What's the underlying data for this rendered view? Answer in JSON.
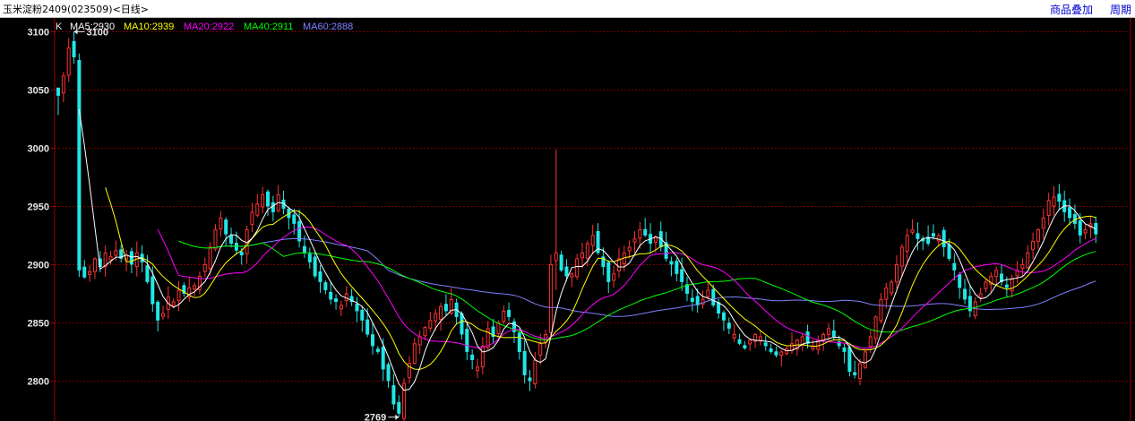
{
  "window": {
    "title": "玉米淀粉2409(023509)<日线>",
    "overlay_link": "商品叠加",
    "period_link": "周期"
  },
  "colors": {
    "background": "#000000",
    "axis": "#a00000",
    "grid": "#7a0000",
    "up_candle": "#ff3232",
    "down_candle": "#22e6e6",
    "axis_text": "#e6e6e6",
    "ma5": "#ffffff",
    "ma10": "#ffff00",
    "ma20": "#ff00ff",
    "ma40": "#00ff00",
    "ma60": "#8080ff"
  },
  "chart_data": {
    "type": "candlestick",
    "ylim": [
      2768,
      3108
    ],
    "y_ticks": [
      2800,
      2850,
      2900,
      2950,
      3000,
      3050,
      3100
    ],
    "grid": true,
    "legend_position": "top-left",
    "legend": {
      "k": "K",
      "ma5": "MA5:2930",
      "ma10": "MA10:2939",
      "ma20": "MA20:2922",
      "ma40": "MA40:2911",
      "ma60": "MA60:2888"
    },
    "annotations": {
      "high": {
        "label": "3100",
        "value": 3100,
        "bar": 3
      },
      "low": {
        "label": "2769",
        "value": 2769,
        "bar": 65
      }
    },
    "ma_start": {
      "ma5": 4,
      "ma10": 9,
      "ma20": 19,
      "ma40": 23,
      "ma60": 29
    },
    "closes": [
      3045,
      3062,
      3086,
      3078,
      2895,
      2889,
      2894,
      2905,
      2898,
      2910,
      2907,
      2912,
      2905,
      2908,
      2900,
      2910,
      2902,
      2885,
      2866,
      2852,
      2858,
      2872,
      2868,
      2878,
      2875,
      2880,
      2882,
      2890,
      2900,
      2915,
      2930,
      2940,
      2926,
      2918,
      2912,
      2908,
      2930,
      2945,
      2952,
      2960,
      2950,
      2945,
      2960,
      2948,
      2940,
      2935,
      2920,
      2910,
      2902,
      2890,
      2885,
      2878,
      2870,
      2868,
      2865,
      2875,
      2868,
      2860,
      2852,
      2840,
      2830,
      2825,
      2810,
      2800,
      2780,
      2772,
      2798,
      2815,
      2832,
      2838,
      2846,
      2852,
      2858,
      2864,
      2860,
      2870,
      2855,
      2840,
      2825,
      2818,
      2812,
      2830,
      2845,
      2838,
      2850,
      2860,
      2855,
      2842,
      2825,
      2805,
      2800,
      2818,
      2832,
      2840,
      2900,
      2910,
      2895,
      2890,
      2892,
      2905,
      2910,
      2918,
      2925,
      2910,
      2898,
      2885,
      2892,
      2905,
      2910,
      2915,
      2922,
      2930,
      2925,
      2918,
      2924,
      2915,
      2905,
      2900,
      2892,
      2885,
      2875,
      2868,
      2865,
      2870,
      2878,
      2865,
      2858,
      2852,
      2845,
      2840,
      2832,
      2828,
      2835,
      2840,
      2838,
      2830,
      2825,
      2822,
      2825,
      2828,
      2832,
      2835,
      2838,
      2832,
      2830,
      2835,
      2840,
      2845,
      2838,
      2830,
      2825,
      2808,
      2805,
      2815,
      2825,
      2838,
      2855,
      2870,
      2880,
      2885,
      2900,
      2915,
      2925,
      2930,
      2922,
      2920,
      2918,
      2924,
      2925,
      2915,
      2905,
      2895,
      2880,
      2870,
      2860,
      2868,
      2875,
      2885,
      2890,
      2895,
      2885,
      2880,
      2888,
      2895,
      2900,
      2910,
      2920,
      2930,
      2940,
      2955,
      2958,
      2954,
      2945,
      2940,
      2935,
      2925,
      2930,
      2935,
      2926
    ]
  }
}
